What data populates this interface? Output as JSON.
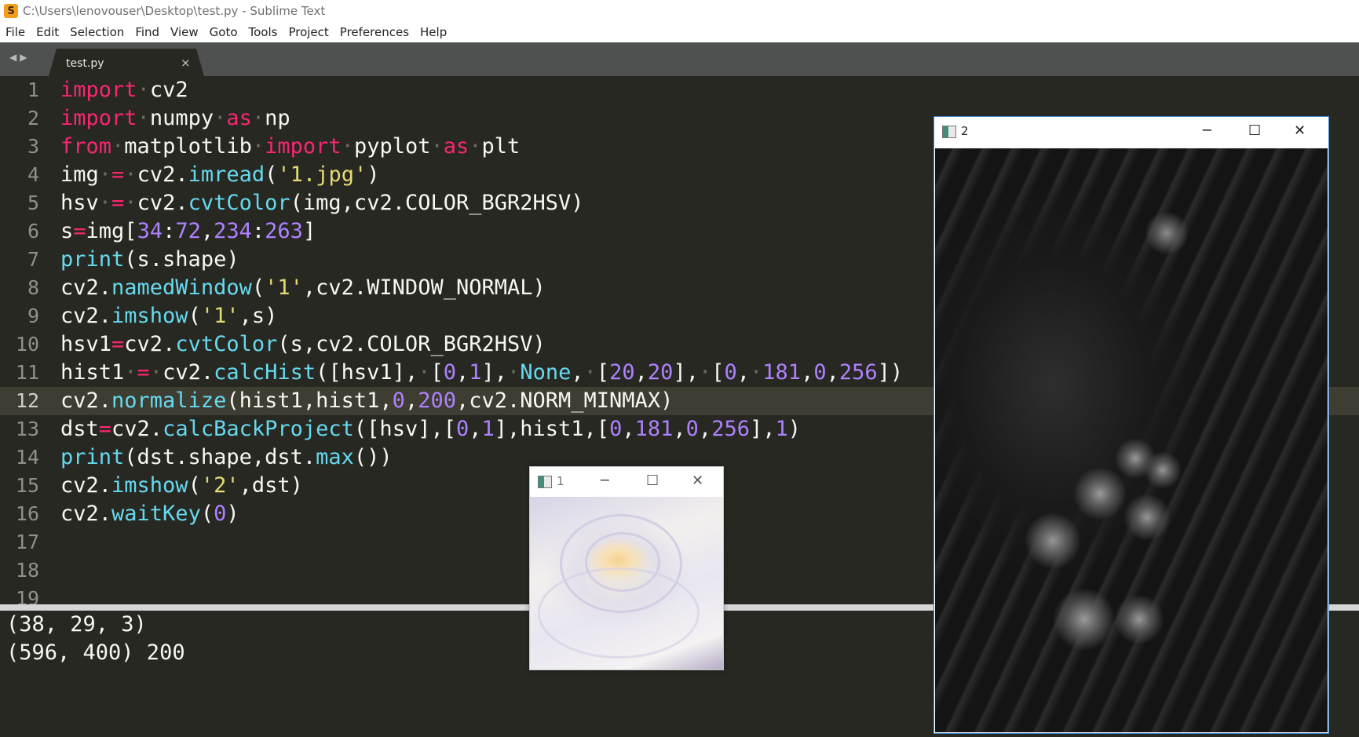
{
  "window": {
    "title": "C:\\Users\\lenovouser\\Desktop\\test.py - Sublime Text"
  },
  "menu": [
    "File",
    "Edit",
    "Selection",
    "Find",
    "View",
    "Goto",
    "Tools",
    "Project",
    "Preferences",
    "Help"
  ],
  "tabs": [
    {
      "label": "test.py",
      "close": "×"
    }
  ],
  "editor": {
    "current_line": 12,
    "line_numbers": [
      "1",
      "2",
      "3",
      "4",
      "5",
      "6",
      "7",
      "8",
      "9",
      "10",
      "11",
      "12",
      "13",
      "14",
      "15",
      "16",
      "17",
      "18",
      "19"
    ],
    "lines": [
      "import cv2",
      "import numpy as np",
      "from matplotlib import pyplot as plt",
      "img = cv2.imread('1.jpg')",
      "hsv = cv2.cvtColor(img,cv2.COLOR_BGR2HSV)",
      "s=img[34:72,234:263]",
      "print(s.shape)",
      "cv2.namedWindow('1',cv2.WINDOW_NORMAL)",
      "cv2.imshow('1',s)",
      "hsv1=cv2.cvtColor(s,cv2.COLOR_BGR2HSV)",
      "hist1 = cv2.calcHist([hsv1], [0,1], None, [20,20], [0, 181,0,256])",
      "cv2.normalize(hist1,hist1,0,200,cv2.NORM_MINMAX)",
      "dst=cv2.calcBackProject([hsv],[0,1],hist1,[0,181,0,256],1)",
      "print(dst.shape,dst.max())",
      "cv2.imshow('2',dst)",
      "cv2.waitKey(0)",
      "",
      ""
    ]
  },
  "output": {
    "lines": [
      "(38, 29, 3)",
      "(596, 400) 200"
    ]
  },
  "image_windows": [
    {
      "title": "1",
      "content": "cropped rose patch (pale cream/lavender)"
    },
    {
      "title": "2",
      "content": "grayscale back-projection of illustration"
    }
  ],
  "window_controls": {
    "minimize": "─",
    "maximize": "☐",
    "close": "✕"
  },
  "colors": {
    "editor_bg": "#272822",
    "keyword": "#f92672",
    "function": "#66d9ef",
    "string": "#e6db74",
    "number": "#ae81ff",
    "text": "#f8f8f2"
  }
}
